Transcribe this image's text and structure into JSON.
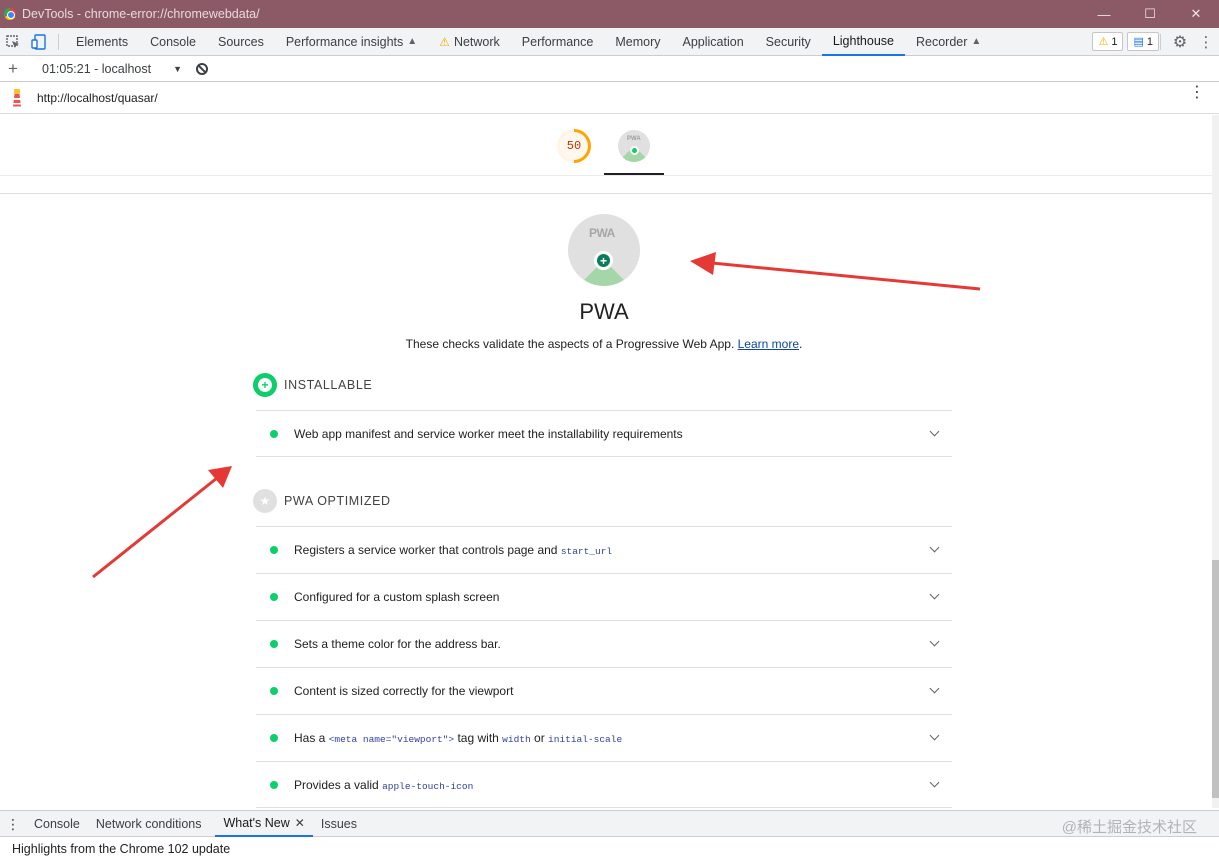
{
  "window": {
    "title": "DevTools - chrome-error://chromewebdata/",
    "controls": [
      "—",
      "☐",
      "✕"
    ]
  },
  "devtools": {
    "tabs": [
      {
        "label": "Elements"
      },
      {
        "label": "Console"
      },
      {
        "label": "Sources"
      },
      {
        "label": "Performance insights"
      },
      {
        "label": "Network"
      },
      {
        "label": "Performance"
      },
      {
        "label": "Memory"
      },
      {
        "label": "Application"
      },
      {
        "label": "Security"
      },
      {
        "label": "Lighthouse"
      },
      {
        "label": "Recorder"
      }
    ],
    "active_tab": "Lighthouse",
    "warnings_count": "1",
    "messages_count": "1"
  },
  "lighthouse": {
    "report_select": "01:05:21 - localhost",
    "url": "http://localhost/quasar/",
    "score_gauge": "50",
    "pwa_badge_text": "PWA",
    "category": {
      "title": "PWA",
      "description": "These checks validate the aspects of a Progressive Web App.",
      "learn_more": "Learn more",
      "period": "."
    },
    "groups": {
      "installable": {
        "title": "INSTALLABLE",
        "audits": [
          {
            "text": "Web app manifest and service worker meet the installability requirements"
          }
        ]
      },
      "optimized": {
        "title": "PWA OPTIMIZED",
        "audits": [
          {
            "text": "Registers a service worker that controls page and",
            "code1": "start_url"
          },
          {
            "text": "Configured for a custom splash screen"
          },
          {
            "text": "Sets a theme color for the address bar."
          },
          {
            "text": "Content is sized correctly for the viewport"
          },
          {
            "text": "Has a",
            "code1": "<meta name=\"viewport\">",
            "text2": "tag with",
            "code2": "width",
            "text3": "or",
            "code3": "initial-scale"
          },
          {
            "text": "Provides a valid",
            "code1": "apple-touch-icon"
          }
        ]
      }
    }
  },
  "drawer": {
    "tabs": [
      {
        "label": "Console"
      },
      {
        "label": "Network conditions"
      },
      {
        "label": "What's New"
      },
      {
        "label": "Issues"
      }
    ],
    "content": "Highlights from the Chrome 102 update"
  },
  "watermark": "@稀土掘金技术社区",
  "colors": {
    "pass": "#0cce6b",
    "average": "#ffa400",
    "annotation_arrow": "#e53935",
    "active_tab": "#1a73e8"
  },
  "icons": [
    "chrome-logo-icon",
    "inspect-element-icon",
    "device-toolbar-icon",
    "warning-icon",
    "flask-icon",
    "message-icon",
    "settings-icon",
    "more-vert-icon",
    "add-icon",
    "block-icon",
    "lighthouse-logo-icon",
    "pwa-icon",
    "chevron-down-icon",
    "star-icon",
    "close-icon"
  ]
}
